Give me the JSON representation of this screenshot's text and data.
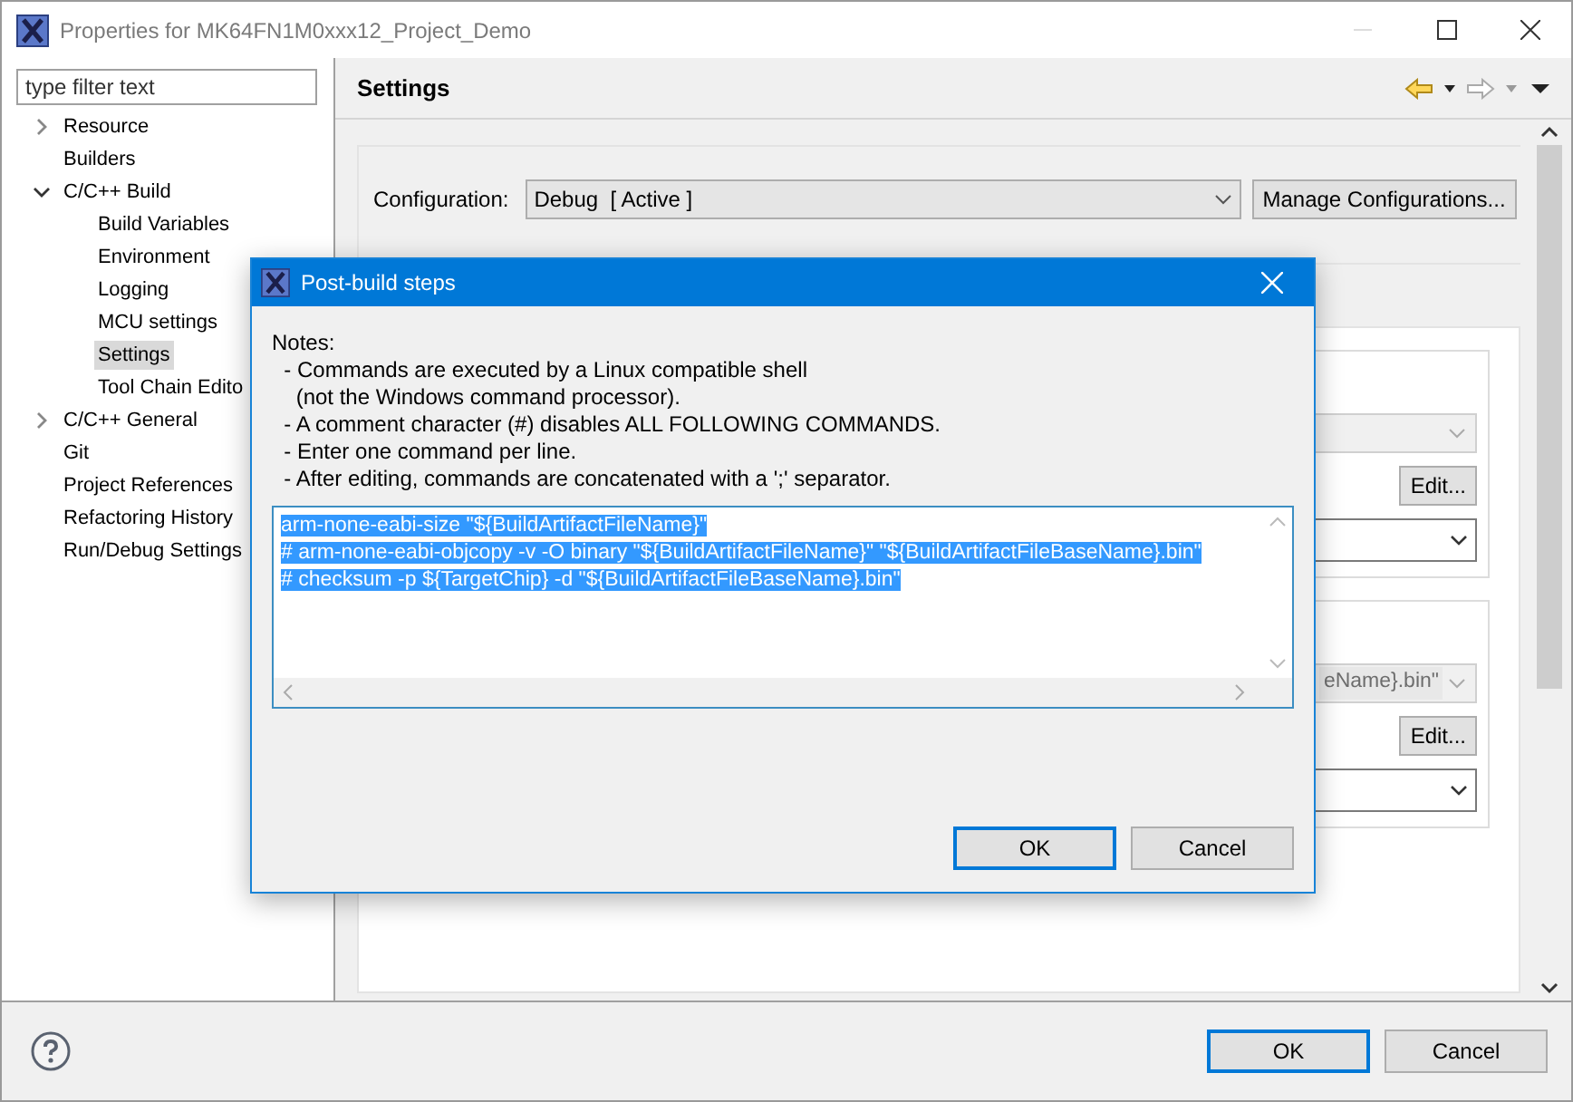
{
  "window": {
    "title": "Properties for MK64FN1M0xxx12_Project_Demo"
  },
  "filter": {
    "placeholder": "type filter text"
  },
  "tree": [
    {
      "label": "Resource",
      "expanded": false,
      "selected": false
    },
    {
      "label": "Builders",
      "selected": false
    },
    {
      "label": "C/C++ Build",
      "expanded": true,
      "selected": false,
      "children": [
        {
          "label": "Build Variables",
          "selected": false
        },
        {
          "label": "Environment",
          "selected": false
        },
        {
          "label": "Logging",
          "selected": false
        },
        {
          "label": "MCU settings",
          "selected": false
        },
        {
          "label": "Settings",
          "selected": true
        },
        {
          "label": "Tool Chain Edito",
          "selected": false
        }
      ]
    },
    {
      "label": "C/C++ General",
      "expanded": false,
      "selected": false
    },
    {
      "label": "Git",
      "selected": false
    },
    {
      "label": "Project References",
      "selected": false
    },
    {
      "label": "Refactoring History",
      "selected": false
    },
    {
      "label": "Run/Debug Settings",
      "selected": false
    }
  ],
  "page": {
    "title": "Settings",
    "configuration_label": "Configuration:",
    "configuration": "Debug  [ Active ]",
    "manage_button": "Manage Configurations..."
  },
  "groups": [
    {
      "button": "Edit..."
    },
    {
      "combo_text": "eName}.bin\"",
      "button": "Edit..."
    }
  ],
  "dialog": {
    "title": "Post-build steps",
    "notes": "Notes:\n  - Commands are executed by a Linux compatible shell\n    (not the Windows command processor).\n  - A comment character (#) disables ALL FOLLOWING COMMANDS.\n  - Enter one command per line.\n  - After editing, commands are concatenated with a ';' separator.",
    "commands": [
      {
        "text": "arm-none-eabi-size \"${BuildArtifactFileName}\"",
        "selected": true
      },
      {
        "text": "# arm-none-eabi-objcopy -v -O binary \"${BuildArtifactFileName}\" \"${BuildArtifactFileBaseName}.bin\"",
        "selected": true
      },
      {
        "text": "# checksum -p ${TargetChip} -d \"${BuildArtifactFileBaseName}.bin\"",
        "selected": true
      }
    ],
    "buttons": [
      {
        "label": "OK",
        "default": true
      },
      {
        "label": "Cancel",
        "default": false
      }
    ]
  },
  "buttons": [
    {
      "label": "OK",
      "default": true
    },
    {
      "label": "Cancel",
      "default": false
    }
  ]
}
